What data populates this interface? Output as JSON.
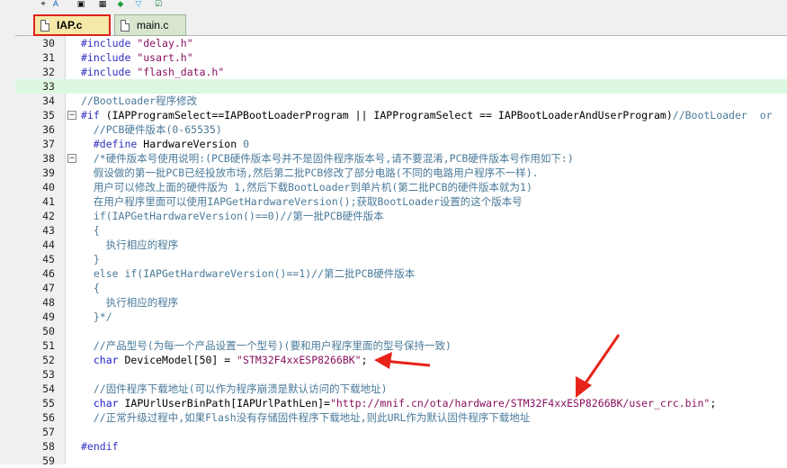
{
  "tabs": [
    {
      "label": "IAP.c",
      "active": true
    },
    {
      "label": "main.c",
      "active": false
    }
  ],
  "lines": [
    {
      "num": "30",
      "code": "#include \"delay.h\"",
      "style": "pp"
    },
    {
      "num": "31",
      "code": "#include \"usart.h\"",
      "style": "pp"
    },
    {
      "num": "32",
      "code": "#include \"flash_data.h\"",
      "style": "pp"
    },
    {
      "num": "33",
      "code": "",
      "style": "plain",
      "highlight": true
    },
    {
      "num": "34",
      "code": "//BootLoader程序修改",
      "style": "comment"
    },
    {
      "num": "35",
      "code": "#if (IAPProgramSelect==IAPBootLoaderProgram || IAPProgramSelect == IAPBootLoaderAndUserProgram)//BootLoader  or",
      "style": "mixed-if",
      "fold": "−"
    },
    {
      "num": "36",
      "code": "  //PCB硬件版本(0-65535)",
      "style": "comment"
    },
    {
      "num": "37",
      "code": "  #define HardwareVersion 0",
      "style": "define"
    },
    {
      "num": "38",
      "code": "  /*硬件版本号使用说明:(PCB硬件版本号并不是固件程序版本号,请不要混淆,PCB硬件版本号作用如下:)",
      "style": "comment",
      "fold": "−"
    },
    {
      "num": "39",
      "code": "  假设做的第一批PCB已经投放市场,然后第二批PCB修改了部分电路(不同的电路用户程序不一样).",
      "style": "comment"
    },
    {
      "num": "40",
      "code": "  用户可以修改上面的硬件版为 1,然后下载BootLoader到单片机(第二批PCB的硬件版本就为1)",
      "style": "comment"
    },
    {
      "num": "41",
      "code": "  在用户程序里面可以使用IAPGetHardwareVersion();获取BootLoader设置的这个版本号",
      "style": "comment"
    },
    {
      "num": "42",
      "code": "  if(IAPGetHardwareVersion()==0)//第一批PCB硬件版本",
      "style": "comment"
    },
    {
      "num": "43",
      "code": "  {",
      "style": "comment"
    },
    {
      "num": "44",
      "code": "    执行相应的程序",
      "style": "comment"
    },
    {
      "num": "45",
      "code": "  }",
      "style": "comment"
    },
    {
      "num": "46",
      "code": "  else if(IAPGetHardwareVersion()==1)//第二批PCB硬件版本",
      "style": "comment"
    },
    {
      "num": "47",
      "code": "  {",
      "style": "comment"
    },
    {
      "num": "48",
      "code": "    执行相应的程序",
      "style": "comment"
    },
    {
      "num": "49",
      "code": "  }*/",
      "style": "comment"
    },
    {
      "num": "50",
      "code": "",
      "style": "plain"
    },
    {
      "num": "51",
      "code": "  //产品型号(为每一个产品设置一个型号)(要和用户程序里面的型号保持一致)",
      "style": "comment"
    },
    {
      "num": "52",
      "code": "  char DeviceModel[50] = \"STM32F4xxESP8266BK\";",
      "style": "char-decl"
    },
    {
      "num": "53",
      "code": "",
      "style": "plain"
    },
    {
      "num": "54",
      "code": "  //固件程序下载地址(可以作为程序崩溃是默认访问的下载地址)",
      "style": "comment"
    },
    {
      "num": "55",
      "code": "  char IAPUrlUserBinPath[IAPUrlPathLen]=\"http://mnif.cn/ota/hardware/STM32F4xxESP8266BK/user_crc.bin\";",
      "style": "char-decl"
    },
    {
      "num": "56",
      "code": "  //正常升级过程中,如果Flash没有存储固件程序下载地址,则此URL作为默认固件程序下载地址",
      "style": "comment"
    },
    {
      "num": "57",
      "code": "",
      "style": "plain"
    },
    {
      "num": "58",
      "code": "#endif",
      "style": "pp"
    },
    {
      "num": "59",
      "code": "",
      "style": "plain"
    }
  ],
  "colors": {
    "comment": "#4a7a9a",
    "keyword": "#1a1ad0",
    "preprocessor": "#3030c0",
    "string": "#8a1060",
    "highlight": "#ddf8e0",
    "arrow": "#e8231a",
    "active_tab_border": "#e0201a"
  }
}
